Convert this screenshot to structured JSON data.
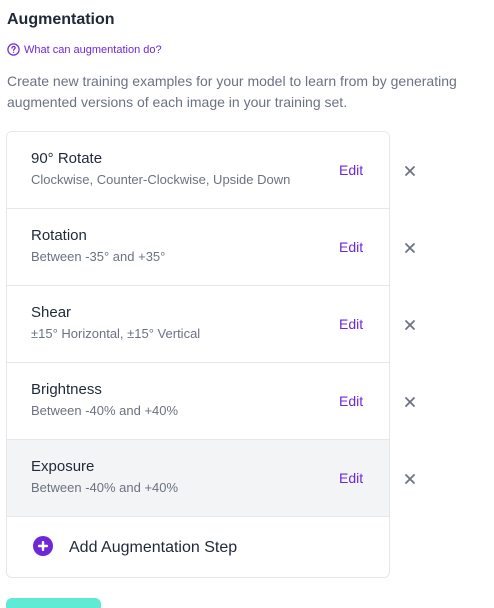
{
  "section": {
    "title": "Augmentation",
    "help_link": "What can augmentation do?",
    "description": "Create new training examples for your model to learn from by generating augmented versions of each image in your training set."
  },
  "steps": [
    {
      "name": "90° Rotate",
      "detail": "Clockwise, Counter-Clockwise, Upside Down",
      "edit_label": "Edit",
      "remove_icon": "close-icon"
    },
    {
      "name": "Rotation",
      "detail": "Between -35° and +35°",
      "edit_label": "Edit",
      "remove_icon": "close-icon"
    },
    {
      "name": "Shear",
      "detail": "±15° Horizontal, ±15° Vertical",
      "edit_label": "Edit",
      "remove_icon": "close-icon"
    },
    {
      "name": "Brightness",
      "detail": "Between -40% and +40%",
      "edit_label": "Edit",
      "remove_icon": "close-icon"
    },
    {
      "name": "Exposure",
      "detail": "Between -40% and +40%",
      "edit_label": "Edit",
      "remove_icon": "close-icon"
    }
  ],
  "add_step": {
    "label": "Add Augmentation Step",
    "icon": "plus-circle-icon"
  },
  "colors": {
    "accent": "#6d28d9",
    "hover_row": "#f3f4f6",
    "border": "#e5e7eb",
    "continue_button": "#5eead4"
  }
}
